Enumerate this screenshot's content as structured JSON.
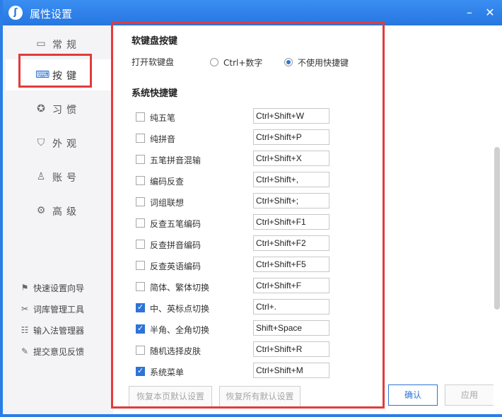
{
  "window": {
    "title": "属性设置",
    "logo_glyph": "ʃ"
  },
  "sidebar": {
    "items": [
      {
        "label": "常规",
        "icon": "monitor-icon"
      },
      {
        "label": "按键",
        "icon": "keyboard-icon"
      },
      {
        "label": "习惯",
        "icon": "star-circle-icon"
      },
      {
        "label": "外观",
        "icon": "shirt-icon"
      },
      {
        "label": "账号",
        "icon": "user-icon"
      },
      {
        "label": "高级",
        "icon": "gear-icon"
      }
    ],
    "active_index": 1,
    "tools": [
      {
        "label": "快速设置向导",
        "icon": "flag-icon"
      },
      {
        "label": "词库管理工具",
        "icon": "tools-icon"
      },
      {
        "label": "输入法管理器",
        "icon": "list-icon"
      },
      {
        "label": "提交意见反馈",
        "icon": "feedback-icon"
      }
    ]
  },
  "soft_keyboard": {
    "section_title": "软键盘按键",
    "row_label": "打开软键盘",
    "options": [
      {
        "label": "Ctrl+数字",
        "checked": false
      },
      {
        "label": "不使用快捷键",
        "checked": true
      }
    ]
  },
  "system_hotkeys": {
    "section_title": "系统快捷键",
    "rows": [
      {
        "name": "纯五笔",
        "checked": false,
        "value": "Ctrl+Shift+W"
      },
      {
        "name": "纯拼音",
        "checked": false,
        "value": "Ctrl+Shift+P"
      },
      {
        "name": "五笔拼音混输",
        "checked": false,
        "value": "Ctrl+Shift+X"
      },
      {
        "name": "编码反查",
        "checked": false,
        "value": "Ctrl+Shift+,"
      },
      {
        "name": "词组联想",
        "checked": false,
        "value": "Ctrl+Shift+;"
      },
      {
        "name": "反查五笔编码",
        "checked": false,
        "value": "Ctrl+Shift+F1"
      },
      {
        "name": "反查拼音编码",
        "checked": false,
        "value": "Ctrl+Shift+F2"
      },
      {
        "name": "反查英语编码",
        "checked": false,
        "value": "Ctrl+Shift+F5"
      },
      {
        "name": "简体、繁体切换",
        "checked": false,
        "value": "Ctrl+Shift+F"
      },
      {
        "name": "中、英标点切换",
        "checked": true,
        "value": "Ctrl+."
      },
      {
        "name": "半角、全角切换",
        "checked": true,
        "value": "Shift+Space"
      },
      {
        "name": "随机选择皮肤",
        "checked": false,
        "value": "Ctrl+Shift+R"
      },
      {
        "name": "系统菜单",
        "checked": true,
        "value": "Ctrl+Shift+M"
      }
    ]
  },
  "footer": {
    "restore_page": "恢复本页默认设置",
    "restore_all": "恢复所有默认设置",
    "ok": "确认",
    "apply": "应用"
  },
  "colors": {
    "accent": "#2f73d6",
    "title_bar": "#2676e0",
    "highlight": "#e23b3b"
  }
}
